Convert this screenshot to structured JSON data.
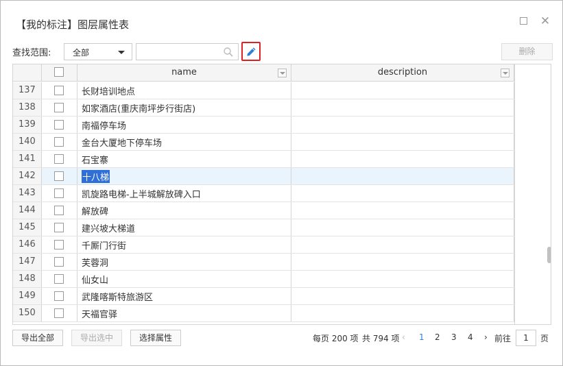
{
  "dialog": {
    "title": "【我的标注】图层属性表"
  },
  "toolbar": {
    "scope_label": "查找范围:",
    "scope_value": "全部",
    "search_value": "",
    "delete_label": "删除"
  },
  "table": {
    "columns": [
      "name",
      "description"
    ],
    "rows": [
      {
        "num": "137",
        "name": "长财培训地点",
        "description": ""
      },
      {
        "num": "138",
        "name": "如家酒店(重庆南坪步行街店)",
        "description": ""
      },
      {
        "num": "139",
        "name": "南福停车场",
        "description": ""
      },
      {
        "num": "140",
        "name": "金台大厦地下停车场",
        "description": ""
      },
      {
        "num": "141",
        "name": "石宝寨",
        "description": ""
      },
      {
        "num": "142",
        "name": "十八梯",
        "description": ""
      },
      {
        "num": "143",
        "name": "凯旋路电梯-上半城解放碑入口",
        "description": ""
      },
      {
        "num": "144",
        "name": "解放碑",
        "description": ""
      },
      {
        "num": "145",
        "name": "建兴坡大梯道",
        "description": ""
      },
      {
        "num": "146",
        "name": "千厮门行街",
        "description": ""
      },
      {
        "num": "147",
        "name": "芙蓉洞",
        "description": ""
      },
      {
        "num": "148",
        "name": "仙女山",
        "description": ""
      },
      {
        "num": "149",
        "name": "武隆喀斯特旅游区",
        "description": ""
      },
      {
        "num": "150",
        "name": "天福官驿",
        "description": ""
      }
    ],
    "selected_row": "142"
  },
  "footer": {
    "export_all": "导出全部",
    "export_selected": "导出选中",
    "select_attributes": "选择属性"
  },
  "pager": {
    "per_page": "每页 200 项",
    "total": "共 794 项",
    "prev": "‹",
    "pages": [
      "1",
      "2",
      "3",
      "4"
    ],
    "current_page": "1",
    "next": "›",
    "goto_label": "前往",
    "goto_value": "1",
    "goto_unit": "页"
  },
  "colors": {
    "accent": "#2f7ed8",
    "highlight_border": "#e02020",
    "selection": "#2f6fd6"
  }
}
